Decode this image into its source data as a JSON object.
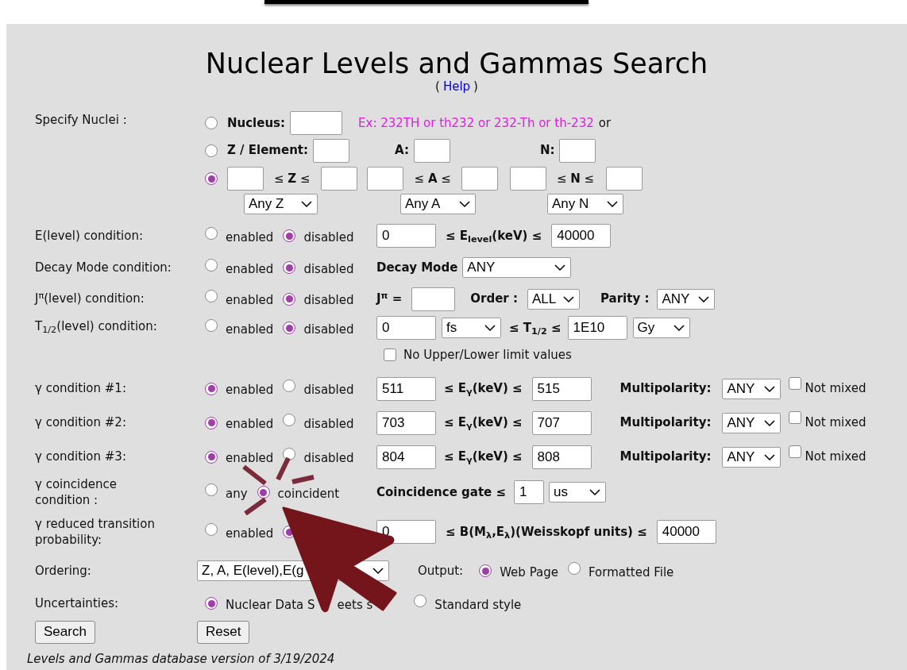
{
  "title": "Nuclear Levels and Gammas Search",
  "help": {
    "before": "(",
    "link": "Help",
    "after": ")"
  },
  "nuclei": {
    "label": "Specify Nuclei :",
    "nucleus": {
      "selected": false,
      "label": "Nucleus:",
      "example": "Ex: 232TH or th232 or 232-Th or th-232",
      "suffix": "or"
    },
    "z_element": {
      "selected": false,
      "label": "Z / Element:",
      "a_label": "A:",
      "n_label": "N:"
    },
    "range": {
      "selected": true,
      "z_text": "≤ **Z** ≤",
      "a_text": "≤ **A** ≤",
      "n_text": "≤ **N** ≤"
    },
    "selects": [
      "Any Z",
      "Any A",
      "Any N"
    ]
  },
  "conditions": [
    {
      "kind": "level",
      "label": "E(level) condition:",
      "options": [
        {
          "label": "enabled",
          "selected": false
        },
        {
          "label": "disabled",
          "selected": true
        }
      ],
      "min": "0",
      "text": "≤ E$_{level}$(keV) ≤",
      "max": "40000"
    },
    {
      "kind": "decay",
      "label": "Decay Mode condition:",
      "options": [
        {
          "label": "enabled",
          "selected": false
        },
        {
          "label": "disabled",
          "selected": true
        }
      ],
      "field_label": "Decay Mode",
      "value": "ANY"
    },
    {
      "kind": "jpi",
      "label": "J$^{π}$(level) condition:",
      "options": [
        {
          "label": "enabled",
          "selected": false
        },
        {
          "label": "disabled",
          "selected": true
        }
      ],
      "field_label": "J$^{π}$ =",
      "order_label": "Order :",
      "order": "ALL",
      "parity_label": "Parity :",
      "parity": "ANY"
    },
    {
      "kind": "halflife",
      "label": "T$_{1/2}$(level) condition:",
      "options": [
        {
          "label": "enabled",
          "selected": false
        },
        {
          "label": "disabled",
          "selected": true
        }
      ],
      "min": "0",
      "min_unit": "fs",
      "text": "≤ T$_{1/2}$ ≤",
      "max": "1E10",
      "max_unit": "Gy",
      "checkbox": {
        "label": "No Upper/Lower limit values",
        "checked": false
      }
    },
    {
      "kind": "gamma",
      "label": "γ condition #1:",
      "options": [
        {
          "label": "enabled",
          "selected": true
        },
        {
          "label": "disabled",
          "selected": false
        }
      ],
      "min": "511",
      "text": "≤ E$_{γ}$(keV) ≤",
      "max": "515",
      "multipolarity_label": "Multipolarity:",
      "multipolarity": "ANY",
      "checkbox": {
        "label": "Not mixed",
        "checked": false
      }
    },
    {
      "kind": "gamma",
      "label": "γ condition #2:",
      "options": [
        {
          "label": "enabled",
          "selected": true
        },
        {
          "label": "disabled",
          "selected": false
        }
      ],
      "min": "703",
      "text": "≤ E$_{γ}$(keV) ≤",
      "max": "707",
      "multipolarity_label": "Multipolarity:",
      "multipolarity": "ANY",
      "checkbox": {
        "label": "Not mixed",
        "checked": false
      }
    },
    {
      "kind": "gamma",
      "label": "γ condition #3:",
      "options": [
        {
          "label": "enabled",
          "selected": true
        },
        {
          "label": "disabled",
          "selected": false
        }
      ],
      "min": "804",
      "text": "≤ E$_{γ}$(keV) ≤",
      "max": "808",
      "multipolarity_label": "Multipolarity:",
      "multipolarity": "ANY",
      "checkbox": {
        "label": "Not mixed",
        "checked": false
      }
    },
    {
      "kind": "coincidence",
      "label": "γ coincidence condition :",
      "options": [
        {
          "label": "any",
          "selected": false
        },
        {
          "label": "coincident",
          "selected": true
        }
      ],
      "gate_label": "Coincidence gate ≤",
      "gate": "1",
      "unit": "us"
    },
    {
      "kind": "reduced",
      "label": "γ reduced transition probability:",
      "options": [
        {
          "label": "enabled",
          "selected": false
        },
        {
          "selected": true
        }
      ],
      "min": "0",
      "text": "≤ B(M$_{λ}$,E$_{λ}$)(Weisskopf units) ≤",
      "max": "40000"
    }
  ],
  "ordering": {
    "label": "Ordering:",
    "value": "Z, A, E(level),E(g",
    "output_label": "Output:",
    "outputs": [
      {
        "label": "Web Page",
        "selected": true
      },
      {
        "label": "Formatted File",
        "selected": false
      }
    ]
  },
  "uncertainties": {
    "label": "Uncertainties:",
    "options": [
      {
        "label": "Nuclear Data S",
        "rest": "eets s",
        "selected": true
      },
      {
        "label": "Standard style",
        "selected": false
      }
    ]
  },
  "buttons": [
    "Search",
    "Reset"
  ],
  "footer": "Levels and Gammas database version of 3/19/2024"
}
